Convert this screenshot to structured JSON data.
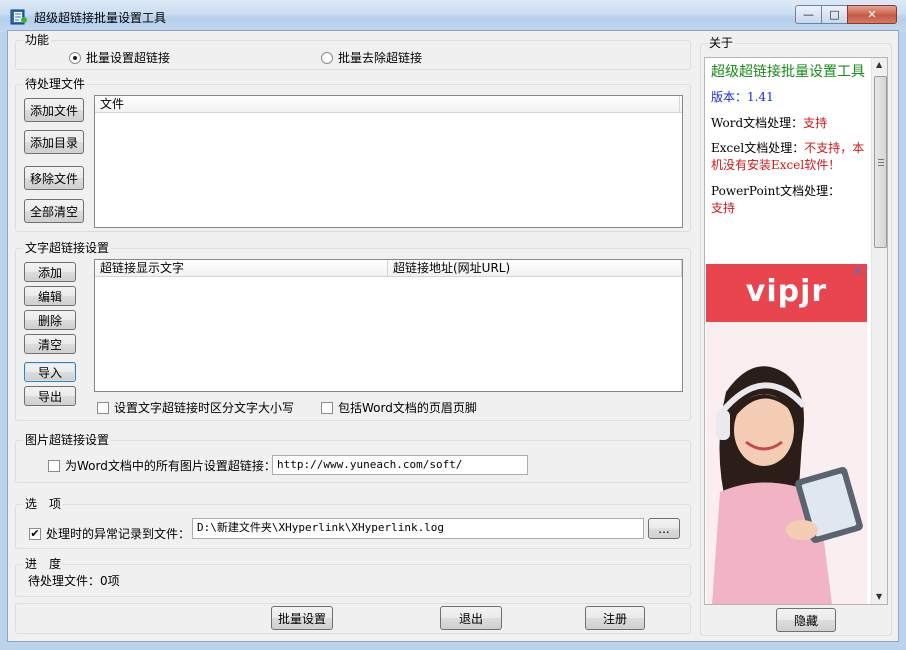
{
  "window": {
    "title": "超级超链接批量设置工具",
    "min_glyph": "—",
    "max_glyph": "□",
    "close_glyph": "✕"
  },
  "function_group": {
    "title": "功能",
    "options": [
      "批量设置超链接",
      "批量去除超链接"
    ],
    "selected": "批量设置超链接"
  },
  "files_group": {
    "title": "待处理文件",
    "buttons": [
      "添加文件",
      "添加目录",
      "移除文件",
      "全部清空"
    ],
    "column": "文件"
  },
  "text_link_group": {
    "title": "文字超链接设置",
    "buttons": [
      "添加",
      "编辑",
      "删除",
      "清空",
      "导入",
      "导出"
    ],
    "columns": [
      "超链接显示文字",
      "超链接地址(网址URL)"
    ],
    "case_sensitive_label": "设置文字超链接时区分文字大小写",
    "case_sensitive_checked": false,
    "header_footer_label": "包括Word文档的页眉页脚",
    "header_footer_checked": false
  },
  "image_link_group": {
    "title": "图片超链接设置",
    "checkbox_label": "为Word文档中的所有图片设置超链接：",
    "checked": false,
    "url": "http://www.yuneach.com/soft/"
  },
  "options_group": {
    "title": "选　项",
    "log_label": "处理时的异常记录到文件：",
    "log_checked": true,
    "log_path": "D:\\新建文件夹\\XHyperlink\\XHyperlink.log",
    "browse_label": "..."
  },
  "progress_group": {
    "title": "进　度",
    "status": "待处理文件：0项"
  },
  "bottom_buttons": {
    "batch_set": "批量设置",
    "exit": "退出",
    "register": "注册"
  },
  "about": {
    "title": "关于",
    "app_name": "超级超链接批量设置工具",
    "version_label": "版本：",
    "version": "1.41",
    "word_label": "Word文档处理：",
    "word_status": "支持",
    "excel_label": "Excel文档处理：",
    "excel_status": "不支持，本机没有安装Excel软件！",
    "ppt_label": "PowerPoint文档处理：",
    "ppt_status": "支持",
    "hide_button": "隐藏",
    "ad_brand": "vipjr",
    "ad_close": "✕"
  },
  "colors": {
    "app_name_green": "#1a8a1a",
    "version_blue": "#1a2fd0",
    "status_red": "#d01818",
    "ad_red": "#e8454f"
  }
}
